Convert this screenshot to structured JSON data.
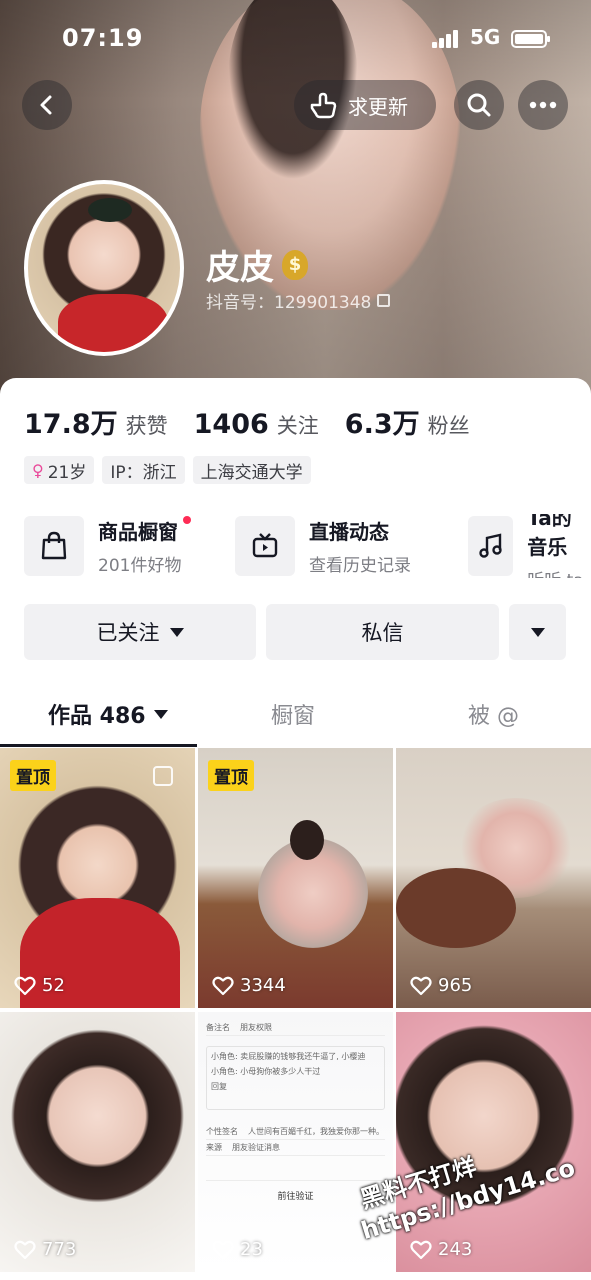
{
  "status_bar": {
    "time": "07:19",
    "network": "5G"
  },
  "header": {
    "update_label": "求更新"
  },
  "profile": {
    "name": "皮皮",
    "badge_icon": "money-bag-icon",
    "douyin_id": "抖音号：129901348"
  },
  "stats": [
    {
      "value": "17.8万",
      "label": "获赞"
    },
    {
      "value": "1406",
      "label": "关注"
    },
    {
      "value": "6.3万",
      "label": "粉丝"
    }
  ],
  "tags": {
    "age": "21岁",
    "ip": "IP：浙江",
    "school": "上海交通大学"
  },
  "entries": [
    {
      "title": "商品橱窗",
      "subtitle": "201件好物",
      "icon": "shopping-bag-icon",
      "dot": true
    },
    {
      "title": "直播动态",
      "subtitle": "查看历史记录",
      "icon": "tv-icon",
      "dot": false
    },
    {
      "title": "Ta的音乐",
      "subtitle": "听听 ta",
      "icon": "music-note-icon",
      "dot": false
    }
  ],
  "actions": {
    "followed": "已关注",
    "message": "私信"
  },
  "tabs": {
    "works": "作品 486",
    "showcase": "橱窗",
    "mentioned": "被 @"
  },
  "grid": [
    {
      "badge": "置顶",
      "likes": "52"
    },
    {
      "badge": "置顶",
      "likes": "3344"
    },
    {
      "badge": "",
      "likes": "965"
    },
    {
      "badge": "",
      "likes": "773"
    },
    {
      "badge": "",
      "likes": "23"
    },
    {
      "badge": "",
      "likes": "243"
    }
  ],
  "doc_card": {
    "field1": "备注名",
    "field1b": "朋友权限",
    "msg1": "小角色: 卖屁股赚的钱够我还牛逼了, 小樱迪",
    "msg2": "小角色: 小母狗你被多少人干过",
    "msg3": "回复",
    "sig_label": "个性签名",
    "sig_value": "人世间有百媚千红，我独爱你那一种。",
    "source_label": "来源",
    "source_value": "朋友验证消息",
    "go": "前往验证"
  },
  "watermark": {
    "line1": "黑料不打烊",
    "line2": "https://bdy14.co"
  }
}
